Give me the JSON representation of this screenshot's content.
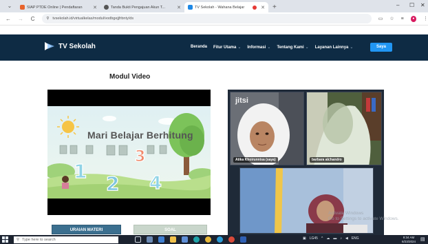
{
  "browser": {
    "tabs": [
      {
        "title": "SIAP PTDE Online | Pendaftaran",
        "favicon_color": "#e8632b",
        "active": false
      },
      {
        "title": "Tanda Bukti Pengajuan Akun T...",
        "favicon_color": "#555555",
        "active": false
      },
      {
        "title": "TV Sekolah - Wahana Belajar",
        "favicon_color": "#1e88e5",
        "active": true
      }
    ],
    "url": "tvsekolah.id/virtualkelas/modul/vodbgejjfrbnty/ds",
    "controls": {
      "minimize": "–",
      "maximize": "☐",
      "close": "✕"
    }
  },
  "site": {
    "brand": "TV Sekolah",
    "nav": [
      {
        "label": "Beranda",
        "has_dropdown": false
      },
      {
        "label": "Fitur Utama",
        "has_dropdown": true
      },
      {
        "label": "Informasi",
        "has_dropdown": true
      },
      {
        "label": "Tentang Kami",
        "has_dropdown": true
      },
      {
        "label": "Layanan Lainnya",
        "has_dropdown": true
      }
    ],
    "user_button": "Saya",
    "header_color": "#0e2b44"
  },
  "main": {
    "section_title": "Modul Video",
    "video": {
      "title": "Mari Belajar Berhitung",
      "numbers": [
        "1",
        "2",
        "3",
        "4"
      ]
    },
    "buttons": {
      "uraian": "URAIAN MATERI",
      "soal": "SOAL"
    }
  },
  "meeting": {
    "logo": "jitsi",
    "participants": [
      {
        "name": "Atika Khoirunnisa (saya)"
      },
      {
        "name": "barbara alchandro"
      },
      {
        "name": ""
      }
    ]
  },
  "os": {
    "watermark_line1": "Activate Windows",
    "watermark_line2": "Go to Settings to activate Windows.",
    "search_placeholder": "Type here to search",
    "tray_text": "LG45",
    "language": "ENG",
    "time": "9:34 AM",
    "date": "6/23/2024"
  }
}
